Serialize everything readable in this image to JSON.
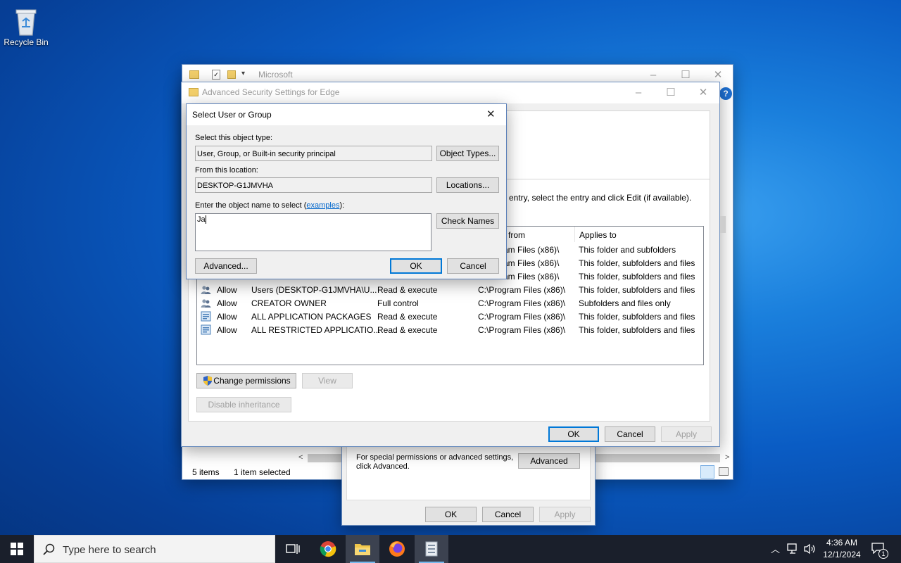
{
  "desktop": {
    "recycle_bin_label": "Recycle Bin"
  },
  "explorer": {
    "title": "Microsoft",
    "status_items": "5 items",
    "status_selected": "1 item selected"
  },
  "properties": {
    "special_text_line1": "For special permissions or advanced settings,",
    "special_text_line2": "click Advanced.",
    "advanced_button": "Advanced",
    "ok_button": "OK",
    "cancel_button": "Cancel",
    "apply_button": "Apply"
  },
  "advsec": {
    "title": "Advanced Security Settings for Edge",
    "instruction_partial": "entry, select the entry and click Edit (if available).",
    "columns": {
      "inherited_partial": "d from",
      "applies_to": "Applies to"
    },
    "entries": [
      {
        "type": "",
        "principal": "",
        "access": "",
        "inherited": "ram Files (x86)\\",
        "applies": "This folder and subfolders",
        "icon": "users-icon"
      },
      {
        "type": "",
        "principal": "",
        "access": "",
        "inherited": "ram Files (x86)\\",
        "applies": "This folder, subfolders and files",
        "icon": "users-icon"
      },
      {
        "type": "",
        "principal": "",
        "access": "",
        "inherited": "ram Files (x86)\\",
        "applies": "This folder, subfolders and files",
        "icon": "users-icon"
      },
      {
        "type": "Allow",
        "principal": "Users (DESKTOP-G1JMVHA\\U...",
        "access": "Read & execute",
        "inherited": "C:\\Program Files (x86)\\",
        "applies": "This folder, subfolders and files",
        "icon": "users-icon"
      },
      {
        "type": "Allow",
        "principal": "CREATOR OWNER",
        "access": "Full control",
        "inherited": "C:\\Program Files (x86)\\",
        "applies": "Subfolders and files only",
        "icon": "users-icon"
      },
      {
        "type": "Allow",
        "principal": "ALL APPLICATION PACKAGES",
        "access": "Read & execute",
        "inherited": "C:\\Program Files (x86)\\",
        "applies": "This folder, subfolders and files",
        "icon": "package-icon"
      },
      {
        "type": "Allow",
        "principal": "ALL RESTRICTED APPLICATIO...",
        "access": "Read & execute",
        "inherited": "C:\\Program Files (x86)\\",
        "applies": "This folder, subfolders and files",
        "icon": "package-icon"
      }
    ],
    "change_permissions_button": "Change permissions",
    "view_button": "View",
    "disable_inheritance_button": "Disable inheritance",
    "ok_button": "OK",
    "cancel_button": "Cancel",
    "apply_button": "Apply"
  },
  "select_dialog": {
    "title": "Select User or Group",
    "object_type_label": "Select this object type:",
    "object_type_value": "User, Group, or Built-in security principal",
    "object_types_button": "Object Types...",
    "location_label": "From this location:",
    "location_value": "DESKTOP-G1JMVHA",
    "locations_button": "Locations...",
    "object_name_label_prefix": "Enter the object name to select (",
    "examples_link": "examples",
    "object_name_label_suffix": "):",
    "object_name_value": "Ja",
    "check_names_button": "Check Names",
    "advanced_button": "Advanced...",
    "ok_button": "OK",
    "cancel_button": "Cancel"
  },
  "taskbar": {
    "search_placeholder": "Type here to search",
    "time": "4:36 AM",
    "date": "12/1/2024",
    "notification_count": "1"
  },
  "colors": {
    "accent": "#0078d7",
    "taskbar": "#1a1f2b",
    "link": "#0066cc"
  }
}
